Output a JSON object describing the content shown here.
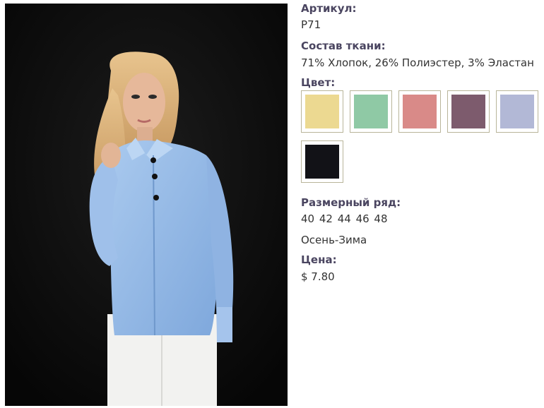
{
  "product": {
    "image_alt": "Model wearing a light blue shirt with black buttons and white trousers"
  },
  "details": {
    "article_label": "Артикул:",
    "article_value": "P71",
    "fabric_label": "Состав ткани:",
    "fabric_value": "71% Хлопок, 26% Полиэстер, 3% Эластан",
    "color_label": "Цвет:",
    "colors": [
      {
        "name": "yellow",
        "hex": "#ecd991"
      },
      {
        "name": "mint",
        "hex": "#8fc9a5"
      },
      {
        "name": "pink",
        "hex": "#d98a88"
      },
      {
        "name": "plum",
        "hex": "#7d5b6d"
      },
      {
        "name": "lavender",
        "hex": "#b2b8d6"
      },
      {
        "name": "black",
        "hex": "#121217"
      }
    ],
    "sizes_label": "Размерный ряд:",
    "sizes_value": "40 42 44 46 48",
    "season_value": "Осень-Зима",
    "price_label": "Цена:",
    "price_value": "$ 7.80"
  }
}
